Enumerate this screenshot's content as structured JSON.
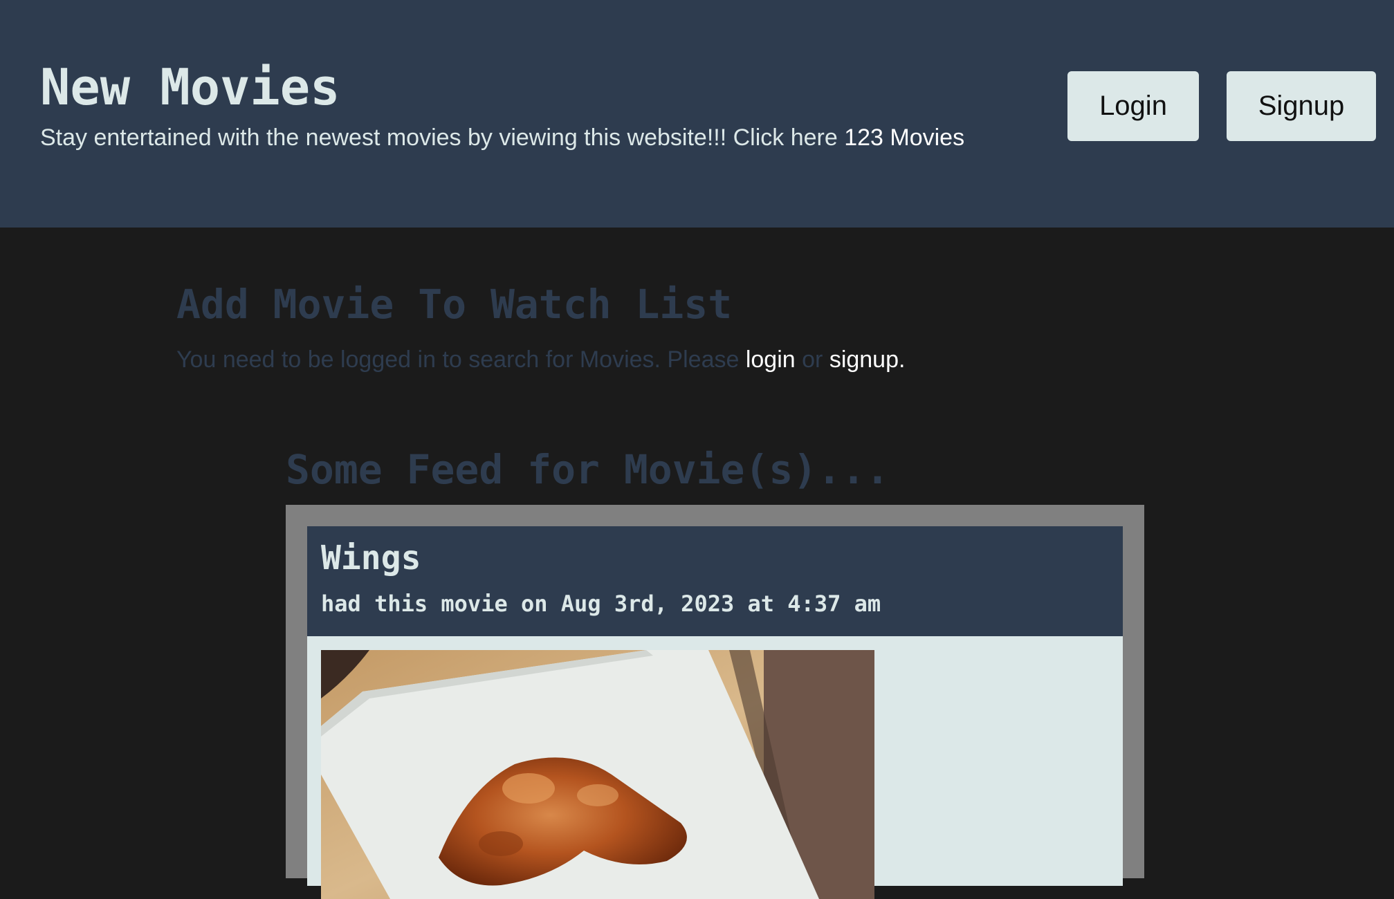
{
  "header": {
    "title": "New Movies",
    "tagline": "Stay entertained with the newest movies by viewing this website!!! Click here ",
    "tagline_link": "123 Movies",
    "login_label": "Login",
    "signup_label": "Signup"
  },
  "add_section": {
    "title": "Add Movie To Watch List",
    "note": "You need to be logged in to search for Movies. Please ",
    "login_link": "login",
    "or_text": " or ",
    "signup_link": "signup."
  },
  "feed": {
    "title": "Some Feed for Movie(s)...",
    "items": [
      {
        "title": "Wings",
        "meta": "had this movie on Aug 3rd, 2023 at 4:37 am",
        "image": "chicken-wing-photo"
      }
    ]
  },
  "colors": {
    "header_bg": "#2e3c4f",
    "page_bg": "#1b1b1b",
    "light_text": "#dce8e8",
    "frame": "#808080"
  }
}
